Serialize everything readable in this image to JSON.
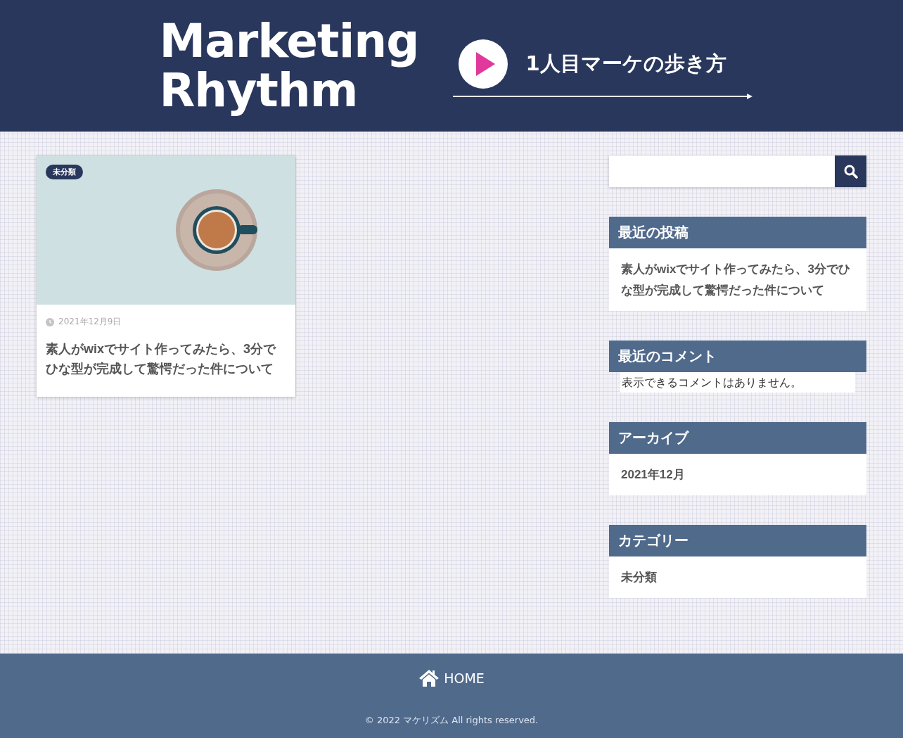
{
  "header": {
    "logo_line_1": "Marketing",
    "logo_line_2": "Rhythm",
    "tagline": "1人目マーケの歩き方"
  },
  "posts": [
    {
      "category": "未分類",
      "date": "2021年12月9日",
      "title": "素人がwixでサイト作ってみたら、3分でひな型が完成して驚愕だった件について"
    }
  ],
  "sidebar": {
    "widgets": [
      {
        "kind": "links",
        "title": "最近の投稿",
        "items": [
          "素人がwixでサイト作ってみたら、3分でひな型が完成して驚愕だった件について"
        ]
      },
      {
        "kind": "note",
        "title": "最近のコメント",
        "items": [
          "表示できるコメントはありません。"
        ]
      },
      {
        "kind": "links",
        "title": "アーカイブ",
        "items": [
          "2021年12月"
        ]
      },
      {
        "kind": "links",
        "title": "カテゴリー",
        "items": [
          "未分類"
        ]
      }
    ]
  },
  "footer": {
    "nav": [
      {
        "label": "HOME"
      }
    ],
    "copyright": "© 2022 マケリズム All rights reserved."
  }
}
